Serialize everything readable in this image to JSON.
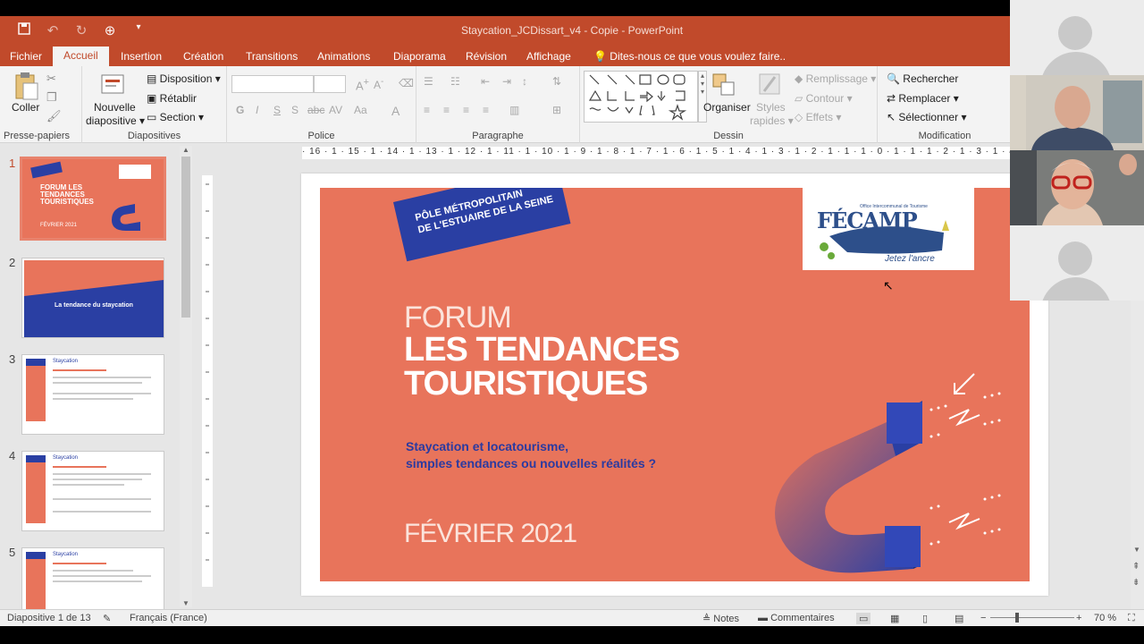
{
  "window": {
    "title": "Staycation_JCDissart_v4 - Copie - PowerPoint"
  },
  "qat": {
    "save_icon": "save-icon",
    "undo_icon": "undo-icon",
    "redo_icon": "redo-icon",
    "present_icon": "present-icon",
    "more_icon": "customize-icon"
  },
  "tabs": [
    "Fichier",
    "Accueil",
    "Insertion",
    "Création",
    "Transitions",
    "Animations",
    "Diaporama",
    "Révision",
    "Affichage"
  ],
  "tell_me": "Dites-nous ce que vous voulez faire..",
  "ribbon": {
    "clipboard": {
      "paste": "Coller",
      "label": "Presse-papiers"
    },
    "slides": {
      "new_slide_line1": "Nouvelle",
      "new_slide_line2": "diapositive",
      "layout": "Disposition",
      "reset": "Rétablir",
      "section": "Section",
      "label": "Diapositives"
    },
    "font": {
      "label": "Police",
      "bold": "G",
      "italic": "I",
      "underline": "S",
      "shadow": "S",
      "strike": "abc",
      "spacing": "AV",
      "case": "Aa",
      "color": "A"
    },
    "paragraph": {
      "label": "Paragraphe"
    },
    "drawing": {
      "arrange": "Organiser",
      "quick_styles_line1": "Styles",
      "quick_styles_line2": "rapides",
      "fill": "Remplissage",
      "outline": "Contour",
      "effects": "Effets",
      "label": "Dessin"
    },
    "editing": {
      "find": "Rechercher",
      "replace": "Remplacer",
      "select": "Sélectionner",
      "label": "Modification"
    }
  },
  "ruler": {
    "h": "· 16 · 1 · 15 · 1 · 14 · 1 · 13 · 1 · 12 · 1 · 11 · 1 · 10 · 1 · 9 · 1 · 8 · 1 · 7 · 1 · 6 · 1 · 5 · 1 · 4 · 1 · 3 · 1 · 2 · 1 · 1 · 1 · 0 · 1 · 1 · 1 · 2 · 1 · 3 · 1 · 4 · 1 · 5 · 1 · 6 · 1 · 7 · 1 · 8 · 1 · 9 · 1 · 10 · 1 · 11 · 1 · 12 · 1 · 13 · 1 · 14 · 1 · 15 · 1 · 16 ·"
  },
  "thumbnails": [
    {
      "num": "1",
      "title": "FORUM LES TENDANCES TOURISTIQUES",
      "date": "FÉVRIER 2021"
    },
    {
      "num": "2",
      "title": "La tendance du staycation"
    },
    {
      "num": "3",
      "title": "Staycation"
    },
    {
      "num": "4",
      "title": "Staycation"
    },
    {
      "num": "5",
      "title": "Staycation"
    }
  ],
  "slide": {
    "banner_line1": "PÔLE MÉTROPOLITAIN",
    "banner_line2": "DE L'ESTUAIRE DE LA SEINE",
    "logo_text": "FÉCAMP",
    "logo_sub": "Jetez l'ancre",
    "logo_office": "Office Intercommunal de Tourisme",
    "forum": "FORUM",
    "title_line1": "LES TENDANCES",
    "title_line2": "TOURISTIQUES",
    "subtitle_line1": "Staycation et locatourisme,",
    "subtitle_line2": "simples tendances ou nouvelles réalités ?",
    "date": "FÉVRIER 2021"
  },
  "status": {
    "slide_info": "Diapositive 1 de 13",
    "language": "Français (France)",
    "notes": "Notes",
    "comments": "Commentaires",
    "zoom": "70 %"
  },
  "colors": {
    "accent": "#c14a2b",
    "slide_bg": "#e8745b",
    "navy": "#2a3fa3",
    "label_blue": "#2b4bb0"
  }
}
